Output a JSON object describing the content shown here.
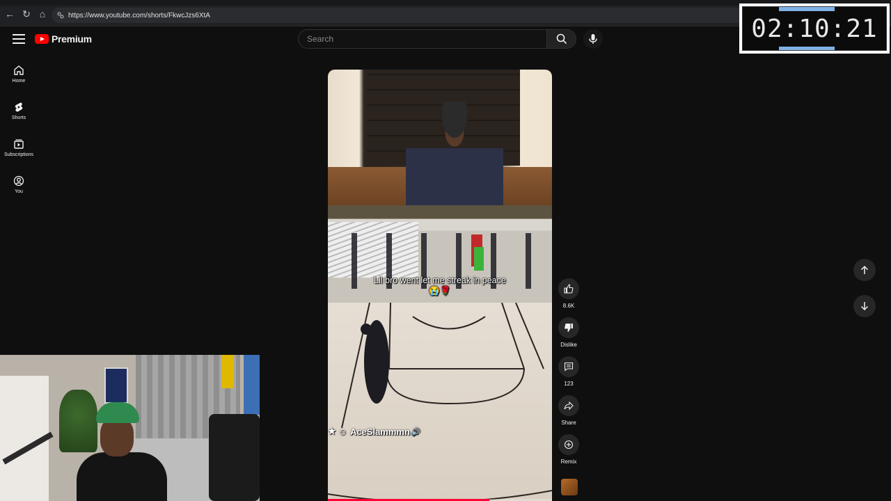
{
  "browser": {
    "url": "https://www.youtube.com/shorts/FkwcJzs6XtA"
  },
  "masthead": {
    "logo_text": "Premium",
    "search_placeholder": "Search"
  },
  "sidebar": {
    "items": [
      {
        "label": "Home",
        "icon": "home-icon"
      },
      {
        "label": "Shorts",
        "icon": "shorts-icon"
      },
      {
        "label": "Subscriptions",
        "icon": "subscriptions-icon"
      },
      {
        "label": "You",
        "icon": "you-icon"
      }
    ]
  },
  "timer": {
    "display": "02:10:21"
  },
  "short": {
    "caption": "Lil bro went let me streak in peace 😭🌹",
    "username": "AceSlammmn",
    "progress": 0.72
  },
  "actions": {
    "like_count": "8.6K",
    "dislike_label": "Dislike",
    "comments_count": "123",
    "share_label": "Share",
    "remix_label": "Remix"
  },
  "colors": {
    "background": "#0f0f0f",
    "brand_red": "#ff0000",
    "progress_red": "#ff0033",
    "timer_accent": "#7fb3e6"
  }
}
